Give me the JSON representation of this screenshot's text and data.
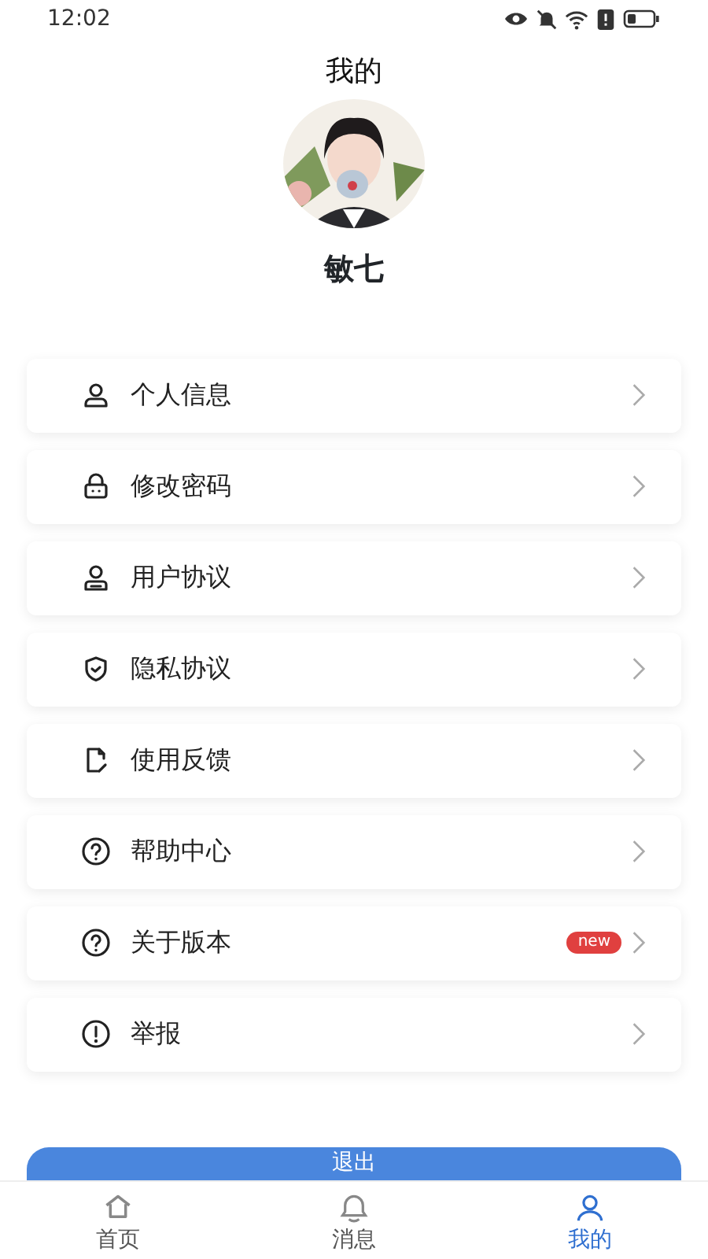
{
  "status_bar": {
    "time": "12:02"
  },
  "header": {
    "title": "我的",
    "username": "敏七"
  },
  "menu": [
    {
      "label": "个人信息"
    },
    {
      "label": "修改密码"
    },
    {
      "label": "用户协议"
    },
    {
      "label": "隐私协议"
    },
    {
      "label": "使用反馈"
    },
    {
      "label": "帮助中心"
    },
    {
      "label": "关于版本",
      "badge": "new"
    },
    {
      "label": "举报"
    }
  ],
  "logout_button": "退出",
  "tab_bar": [
    {
      "label": "首页",
      "selected": false
    },
    {
      "label": "消息",
      "selected": false
    },
    {
      "label": "我的",
      "selected": true
    }
  ]
}
